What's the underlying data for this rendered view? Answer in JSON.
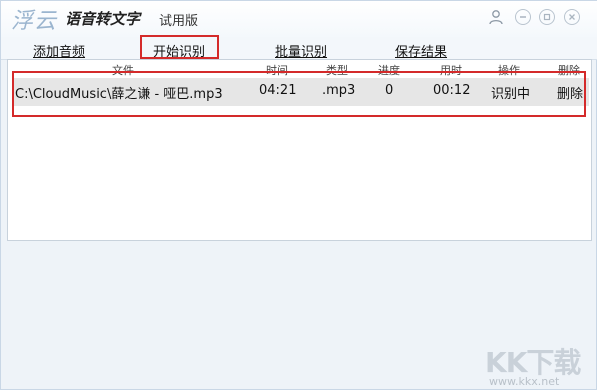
{
  "titlebar": {
    "logo": "浮云",
    "app_title": "语音转文字",
    "edition": "试用版"
  },
  "menu": [
    {
      "label": "添加音频"
    },
    {
      "label": "开始识别"
    },
    {
      "label": "批量识别"
    },
    {
      "label": "保存结果"
    }
  ],
  "table": {
    "columns": [
      "文件",
      "时间",
      "类型",
      "进度",
      "用时",
      "操作",
      "删除"
    ],
    "rows": [
      {
        "file": "C:\\CloudMusic\\薛之谦 - 哑巴.mp3",
        "time": "04:21",
        "type": ".mp3",
        "progress": "0",
        "elapsed": "00:12",
        "action": "识别中",
        "delete": "删除"
      }
    ]
  },
  "watermark": {
    "logo": "KK下载",
    "url": "www.kkx.net"
  },
  "colors": {
    "highlight": "#d42a2a",
    "row_bg": "#e6e6e6",
    "window_bg": "#eef3f8"
  }
}
